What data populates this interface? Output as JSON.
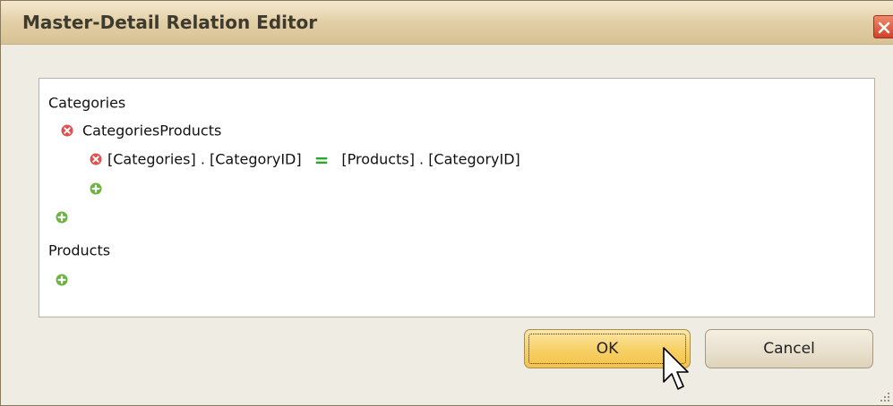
{
  "window": {
    "title": "Master-Detail Relation Editor"
  },
  "tree": {
    "master_table": "Categories",
    "relation_name": "CategoriesProducts",
    "condition": {
      "left": "[Categories] . [CategoryID]",
      "operator": "=",
      "right": "[Products] . [CategoryID]"
    },
    "detail_table": "Products"
  },
  "buttons": {
    "ok_label": "OK",
    "cancel_label": "Cancel"
  },
  "colors": {
    "remove_icon": "#e05050",
    "add_icon": "#6cb442",
    "operator": "#2aa82a",
    "ok_button": "#f7cf63",
    "title_bar": "#e2cfa6"
  },
  "icons": {
    "remove": "remove-icon",
    "add": "add-icon",
    "close": "close-icon",
    "cursor": "mouse-cursor-icon"
  }
}
